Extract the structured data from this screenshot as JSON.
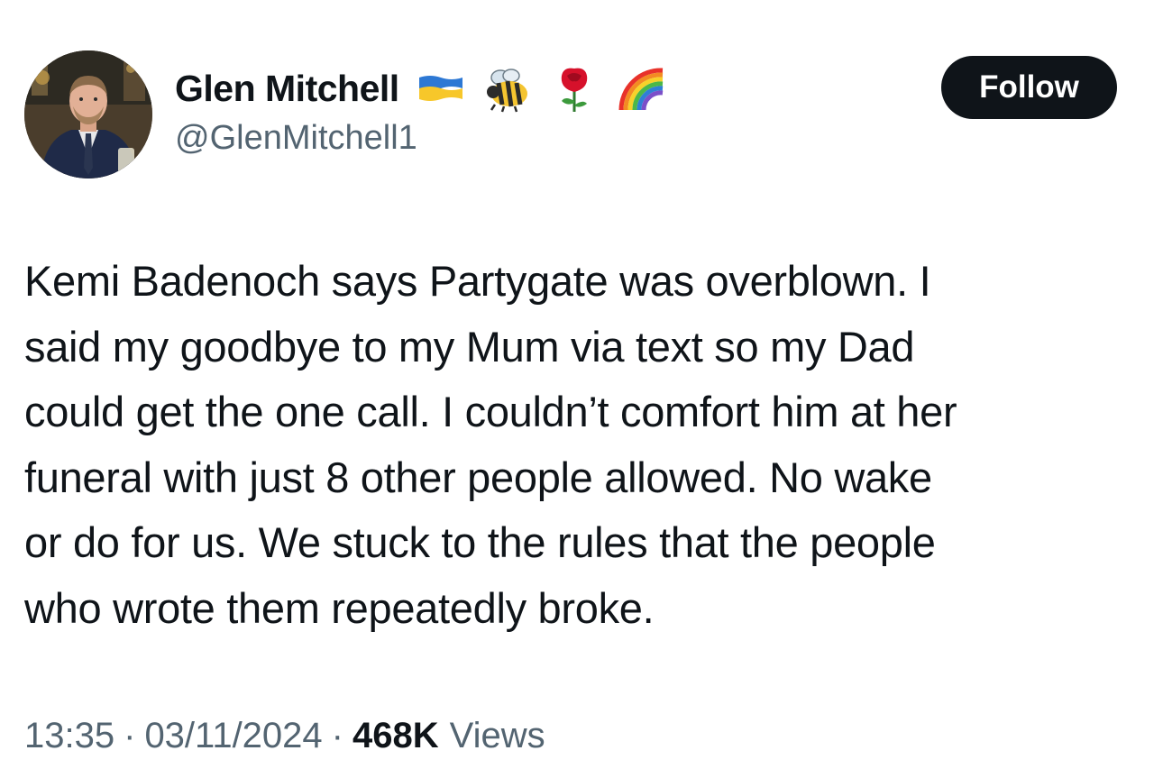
{
  "author": {
    "display_name": "Glen Mitchell",
    "handle": "@GlenMitchell1",
    "name_emojis": [
      "ukraine-flag-icon",
      "bee-icon",
      "rose-icon",
      "rainbow-icon"
    ]
  },
  "follow_button": {
    "label": "Follow"
  },
  "tweet": {
    "lines": [
      "Kemi Badenoch says Partygate was overblown. I",
      "said my goodbye to my Mum via text so my Dad",
      "could get the one call. I couldn’t comfort him at her",
      "funeral with just 8 other people allowed. No wake",
      "or do for us. We stuck to the rules that the people",
      "who wrote them repeatedly broke."
    ]
  },
  "meta": {
    "time": "13:35",
    "separator": "·",
    "date": "03/11/2024",
    "views_count": "468K",
    "views_label": "Views"
  },
  "colors": {
    "text_primary": "#0f1419",
    "text_secondary": "#536471",
    "button_bg": "#0f1419",
    "button_text": "#ffffff"
  }
}
